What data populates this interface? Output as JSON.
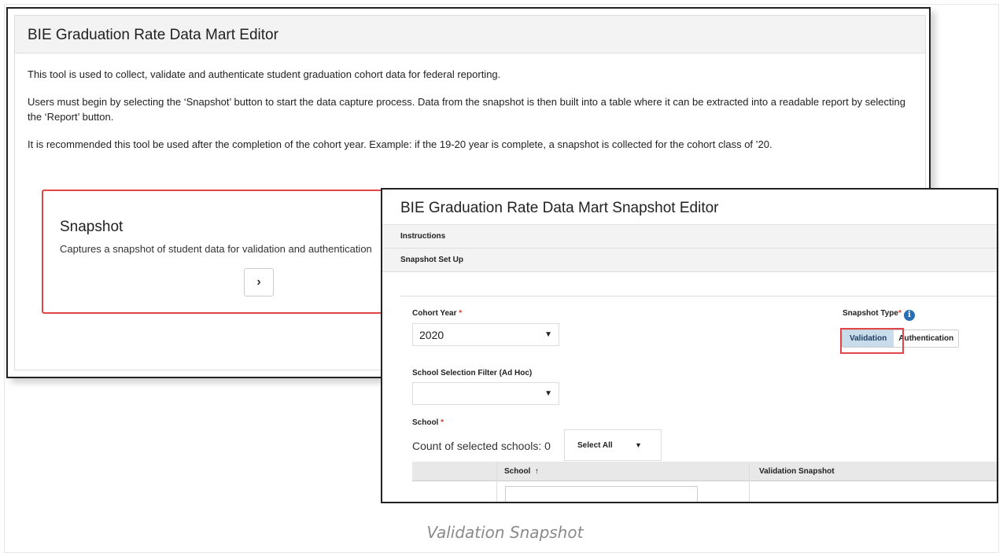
{
  "editor": {
    "title": "BIE Graduation Rate Data Mart Editor",
    "paragraphs": [
      "This tool is used to collect, validate and authenticate student graduation cohort data for federal reporting.",
      "Users must begin by selecting the ‘Snapshot’ button to start the data capture process. Data from the snapshot is then built into a table where it can be extracted into a readable report by selecting the ‘Report’ button.",
      "It is recommended this tool be used after the completion of the cohort year. Example: if the 19-20 year is complete, a snapshot is collected for the cohort class of ’20."
    ],
    "snapshot_card": {
      "title": "Snapshot",
      "description": "Captures a snapshot of student data for validation and authentication",
      "arrow_icon": "chevron-right-icon"
    }
  },
  "snapshot_editor": {
    "title": "BIE Graduation Rate Data Mart Snapshot Editor",
    "sections": {
      "instructions": "Instructions",
      "setup": "Snapshot Set Up"
    },
    "cohort_year": {
      "label": "Cohort Year",
      "value": "2020"
    },
    "snapshot_type": {
      "label": "Snapshot Type",
      "options": [
        "Validation",
        "Authentication"
      ],
      "selected": "Validation"
    },
    "school_filter": {
      "label": "School Selection Filter (Ad Hoc)",
      "value": ""
    },
    "school": {
      "label": "School",
      "count_text": "Count of selected schools: 0",
      "select_all": "Select All"
    },
    "table": {
      "columns": [
        "School",
        "Validation Snapshot"
      ],
      "sort_indicator": "↑"
    }
  },
  "caption": "Validation Snapshot",
  "colors": {
    "highlight": "#e0454a",
    "active_button": "#c9dcec",
    "info_icon": "#2a6eb5",
    "required": "#d9362b"
  }
}
